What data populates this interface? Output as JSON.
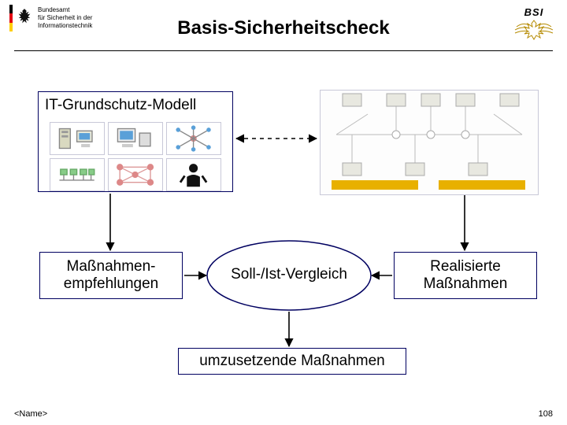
{
  "header": {
    "agency_line1": "Bundesamt",
    "agency_line2": "für Sicherheit in der",
    "agency_line3": "Informationstechnik",
    "logo_text": "BSI"
  },
  "title": "Basis-Sicherheitscheck",
  "boxes": {
    "it_model": "IT-Grundschutz-Modell",
    "recommend_l1": "Maßnahmen-",
    "recommend_l2": "empfehlungen",
    "compare": "Soll-/Ist-Vergleich",
    "realised_l1": "Realisierte",
    "realised_l2": "Maßnahmen",
    "todo": "umzusetzende Maßnahmen"
  },
  "footer": {
    "name_placeholder": "<Name>",
    "page": "108"
  }
}
